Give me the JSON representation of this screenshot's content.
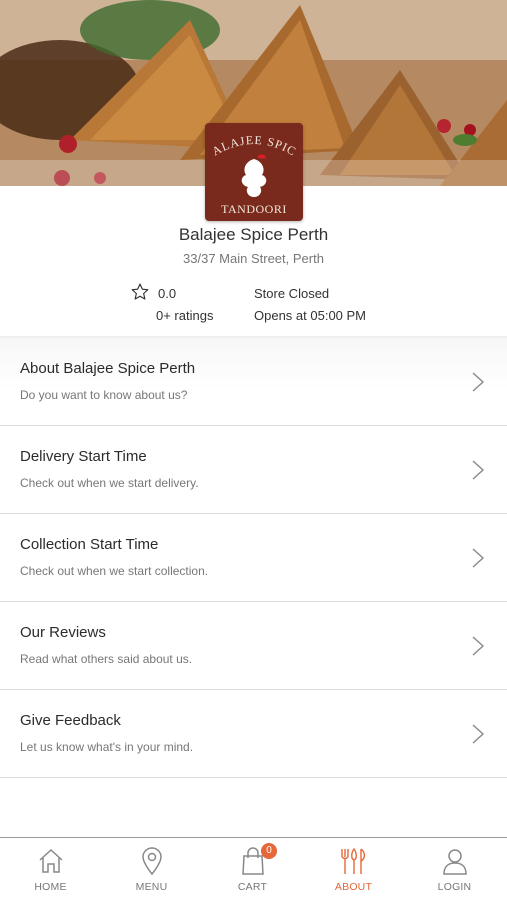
{
  "logo": {
    "line1": "BALAJEE SPICE",
    "line2": "TANDOORI"
  },
  "store": {
    "name": "Balajee Spice Perth",
    "address": "33/37 Main Street, Perth",
    "rating": "0.0",
    "rating_count": "0+ ratings",
    "status": "Store Closed",
    "opens_at": "Opens at 05:00 PM"
  },
  "list": {
    "items": [
      {
        "title": "About Balajee Spice Perth",
        "subtitle": "Do you want to know about us?"
      },
      {
        "title": "Delivery Start Time",
        "subtitle": "Check out when we start delivery."
      },
      {
        "title": "Collection Start Time",
        "subtitle": "Check out when we start collection."
      },
      {
        "title": "Our Reviews",
        "subtitle": "Read what others said about us."
      },
      {
        "title": "Give Feedback",
        "subtitle": "Let us know what's in your mind."
      }
    ]
  },
  "nav": {
    "items": [
      {
        "label": "HOME",
        "icon": "home-icon"
      },
      {
        "label": "MENU",
        "icon": "location-pin-icon"
      },
      {
        "label": "CART",
        "icon": "shopping-bag-icon"
      },
      {
        "label": "ABOUT",
        "icon": "fork-knife-icon"
      },
      {
        "label": "LOGIN",
        "icon": "user-icon"
      }
    ],
    "cart_count": "0",
    "active": "ABOUT"
  },
  "colors": {
    "accent": "#e5673a",
    "logo_bg": "#7a2a1c",
    "text": "#333333",
    "muted": "#777777"
  }
}
